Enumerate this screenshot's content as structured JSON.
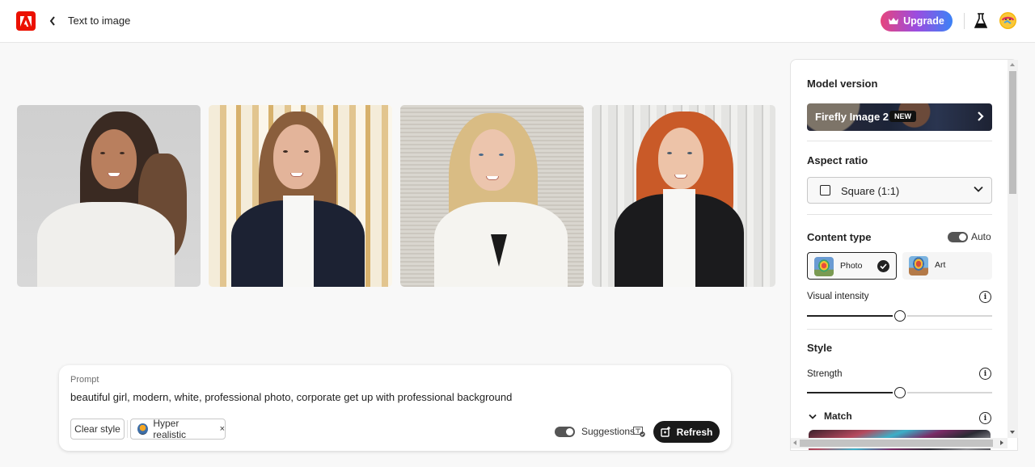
{
  "header": {
    "app_icon": "adobe-logo-icon",
    "back_icon": "chevron-left-icon",
    "title": "Text to image",
    "upgrade_label": "Upgrade",
    "upgrade_icon": "crown-icon",
    "labs_icon": "flask-icon",
    "avatar_icon": "user-avatar"
  },
  "gallery": {
    "images": [
      {
        "alt": "Woman with long wavy dark hair in white blazer, grey background"
      },
      {
        "alt": "Woman with long brown hair in navy blazer, striped gold background"
      },
      {
        "alt": "Blonde woman in white blazer, beige striped background"
      },
      {
        "alt": "Red-haired woman in black blazer, white paneled background"
      }
    ]
  },
  "prompt": {
    "label": "Prompt",
    "value": "beautiful girl, modern, white, professional photo, corporate get up with professional background",
    "clear_style_label": "Clear style",
    "style_tag_label": "Hyper realistic",
    "style_tag_remove": "×",
    "suggestions_label": "Suggestions",
    "suggestions_enabled": true,
    "suggestions_icon": "text-check-icon",
    "refresh_label": "Refresh",
    "refresh_icon": "refresh-sparkle-icon"
  },
  "settings": {
    "model_version": {
      "title": "Model version",
      "value": "Firefly Image 2",
      "badge": "NEW"
    },
    "aspect_ratio": {
      "title": "Aspect ratio",
      "selected": "Square (1:1)"
    },
    "content_type": {
      "title": "Content type",
      "auto_label": "Auto",
      "auto_enabled": true,
      "options": [
        {
          "label": "Photo",
          "selected": true
        },
        {
          "label": "Art",
          "selected": false
        }
      ],
      "visual_intensity_label": "Visual intensity",
      "visual_intensity_value": 0.5
    },
    "style": {
      "title": "Style",
      "strength_label": "Strength",
      "strength_value": 0.5,
      "match_label": "Match"
    }
  },
  "colors": {
    "adobe_red": "#eb1000",
    "upgrade_gradient_start": "#e6457d",
    "upgrade_gradient_end": "#3b82f6",
    "primary_dark": "#1a1a1a"
  }
}
